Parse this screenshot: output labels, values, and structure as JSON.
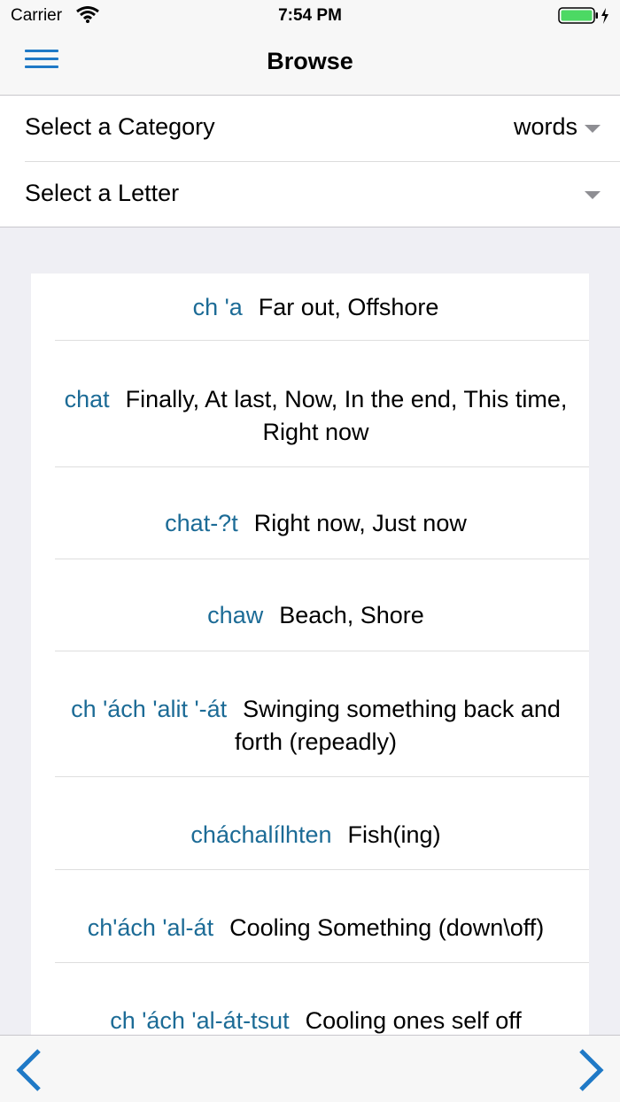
{
  "status_bar": {
    "carrier": "Carrier",
    "time": "7:54 PM"
  },
  "nav": {
    "title": "Browse"
  },
  "selectors": {
    "category_label": "Select a Category",
    "category_value": "words",
    "letter_label": "Select a Letter",
    "letter_value": ""
  },
  "entries": [
    {
      "word": "ch 'a",
      "definition": "Far out, Offshore"
    },
    {
      "word": "chat",
      "definition": "Finally, At last, Now, In the end, This time, Right now"
    },
    {
      "word": "chat-?t",
      "definition": "Right now, Just now"
    },
    {
      "word": "chaw",
      "definition": "Beach, Shore"
    },
    {
      "word": "ch 'ách 'alit '-át",
      "definition": "Swinging something back and forth (repeadly)"
    },
    {
      "word": "cháchalílhten",
      "definition": "Fish(ing)"
    },
    {
      "word": "ch'ách 'al-át",
      "definition": "Cooling Something (down\\off)"
    },
    {
      "word": "ch 'ách 'al-át-tsut",
      "definition": "Cooling ones self off"
    }
  ],
  "colors": {
    "accent": "#1f79c6",
    "word": "#1c6b96",
    "battery": "#4cd964"
  }
}
